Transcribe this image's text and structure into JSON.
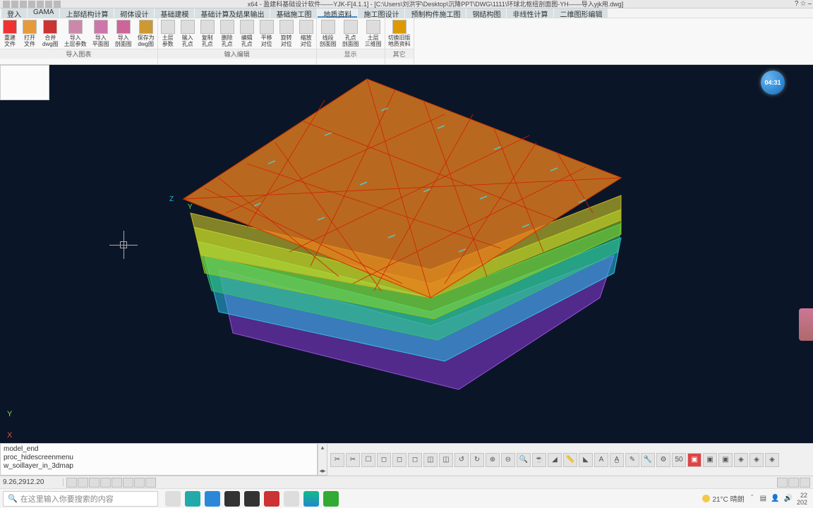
{
  "title": "x64 - 盈建科基础设计软件——YJK-F[4.1.1] - [C:\\Users\\刘洪宇\\Desktop\\沉降PPT\\DWG\\1111\\环球北枢纽剖面图-YH——导入yjk用.dwg]",
  "menus": [
    "登入",
    "GAMA",
    "上部结构计算",
    "砌体设计",
    "基础建模",
    "基础计算及结果输出",
    "基础施工图",
    "地质资料",
    "施工图设计",
    "预制构件施工图",
    "钢结构图",
    "非线性计算",
    "二维图形编辑"
  ],
  "active_menu_index": 7,
  "ribbon": {
    "groups": [
      {
        "footer": "导入图表",
        "buttons": [
          {
            "label": "重建\n文件",
            "ico": "#e33"
          },
          {
            "label": "打开\n文件",
            "ico": "#e79a3a"
          },
          {
            "label": "合并\ndwg图",
            "ico": "#c33"
          },
          {
            "label": "导入\n土层参数",
            "ico": "#c8a"
          },
          {
            "label": "导入\n平面图",
            "ico": "#c7a"
          },
          {
            "label": "导入\n剖面图",
            "ico": "#c69"
          },
          {
            "label": "保存为\ndwg图",
            "ico": "#c93"
          }
        ]
      },
      {
        "footer": "输入编辑",
        "buttons": [
          {
            "label": "土层\n参数",
            "ico": "#aab"
          },
          {
            "label": "输入\n孔点",
            "ico": "#bbb"
          },
          {
            "label": "复制\n孔点",
            "ico": "#b8a"
          },
          {
            "label": "删除\n孔点",
            "ico": "#d88"
          },
          {
            "label": "编辑\n孔点",
            "ico": "#9bd"
          },
          {
            "label": "平移\n对位",
            "ico": "#999"
          },
          {
            "label": "旋转\n对位",
            "ico": "#999"
          },
          {
            "label": "缩放\n对位",
            "ico": "#999"
          }
        ]
      },
      {
        "footer": "显示",
        "buttons": [
          {
            "label": "线段\n剖面图",
            "ico": "#8bb"
          },
          {
            "label": "孔点\n剖面图",
            "ico": "#778"
          },
          {
            "label": "土层\n三维图",
            "ico": "#8ac"
          }
        ]
      },
      {
        "footer": "其它",
        "buttons": [
          {
            "label": "切换旧版\n地质资料",
            "ico": "#d90"
          }
        ]
      }
    ]
  },
  "clock_badge": "04:31",
  "axes": {
    "x": "X",
    "y": "Y",
    "z": "Z"
  },
  "cmd_history": [
    "model_end",
    "proc_hidescreenmenu",
    "w_soillayer_in_3dmap"
  ],
  "status": {
    "coord": "9.26,2912.20"
  },
  "taskbar": {
    "search_placeholder": "在这里输入你要搜索的内容",
    "weather_temp": "21°C 晴朗",
    "time": "22",
    "date": "202"
  }
}
